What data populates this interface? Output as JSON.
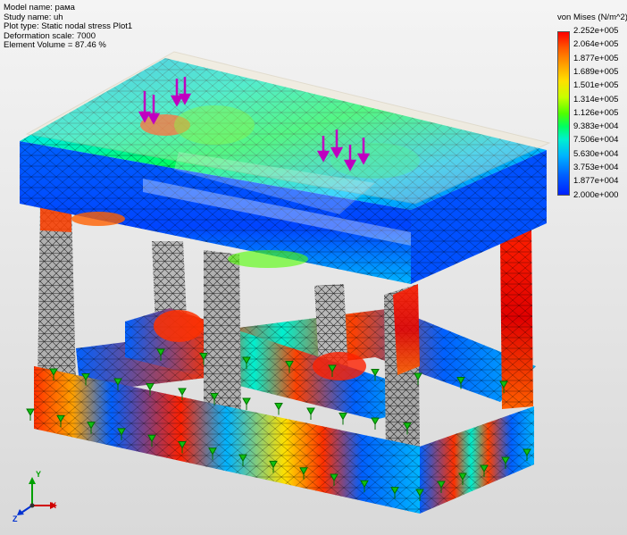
{
  "info": {
    "model_name": "Model name: рама",
    "study_name": "Study name: uh",
    "plot_type": "Plot type: Static nodal stress Plot1",
    "deformation_scale": "Deformation scale: 7000",
    "element_volume": "Element Volume = 87.46 %"
  },
  "legend": {
    "title": "von Mises (N/m^2)",
    "values": [
      "2.252e+005",
      "2.064e+005",
      "1.877e+005",
      "1.689e+005",
      "1.501e+005",
      "1.314e+005",
      "1.126e+005",
      "9.383e+004",
      "7.506e+004",
      "5.630e+004",
      "3.753e+004",
      "1.877e+004",
      "2.000e+000"
    ],
    "colors": {
      "max": "#ff0000",
      "orange": "#ffa000",
      "yellow": "#ffe000",
      "green": "#50ff00",
      "cyan": "#00f0d0",
      "blue": "#0060ff",
      "min": "#0020ff"
    }
  },
  "triad": {
    "x": "X",
    "y": "Y",
    "z": "Z"
  },
  "icons": [
    "load-arrow-icon",
    "fixture-icon",
    "coordinate-triad-icon"
  ]
}
